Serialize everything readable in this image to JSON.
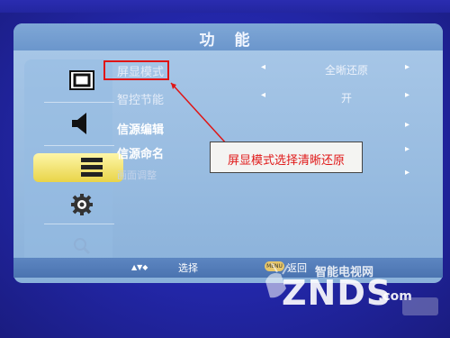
{
  "menu": {
    "title": "功 能",
    "side_icons": [
      "picture-icon",
      "sound-icon",
      "function-icon",
      "settings-gear-icon",
      "search-icon"
    ],
    "active_icon": "function-icon",
    "rows": [
      {
        "label": "屏显模式",
        "value": "全晰还原"
      },
      {
        "label": "智控节能",
        "value": "开"
      },
      {
        "label": "信源编辑",
        "value": ""
      },
      {
        "label": "信源命名",
        "value": ""
      },
      {
        "label": "画面调整",
        "value": ""
      }
    ]
  },
  "footer": {
    "nav_label": "选择",
    "nav_arrows": "▲▼◆",
    "back_label": "返回"
  },
  "annotation": {
    "text": "屏显模式选择清晰还原",
    "color": "#e01818"
  },
  "watermark": {
    "sub": "智能电视网",
    "main": "ZNDS",
    "suffix": ".com"
  }
}
